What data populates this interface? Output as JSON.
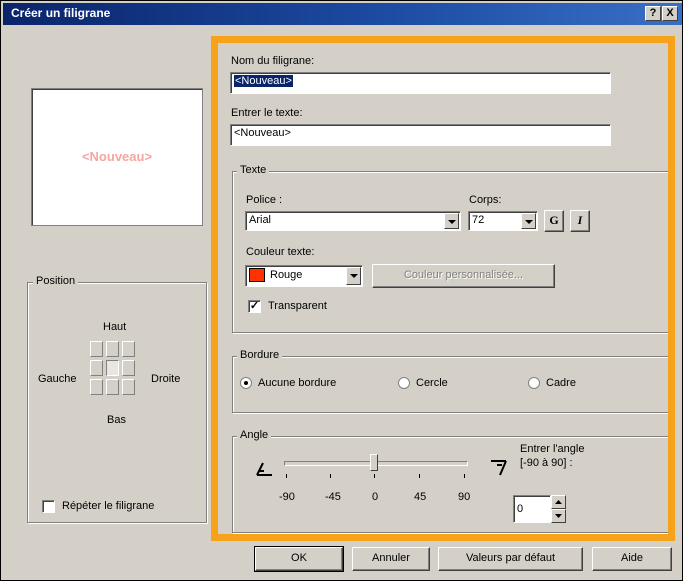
{
  "window": {
    "title": "Créer un filigrane",
    "help_button": "?",
    "close_button": "X"
  },
  "preview": {
    "text": "<Nouveau>"
  },
  "position_group": {
    "legend": "Position",
    "top": "Haut",
    "left": "Gauche",
    "right": "Droite",
    "bottom": "Bas",
    "selected": "center"
  },
  "repeat": {
    "label": "Répéter le filigrane",
    "checked": false
  },
  "name_field": {
    "label": "Nom du filigrane:",
    "value": "<Nouveau>"
  },
  "text_field": {
    "label": "Entrer le texte:",
    "value": "<Nouveau>"
  },
  "text_group": {
    "legend": "Texte",
    "font_label": "Police :",
    "font_value": "Arial",
    "size_label": "Corps:",
    "size_value": "72",
    "bold_label": "G",
    "italic_label": "I",
    "color_label": "Couleur texte:",
    "color_value": "Rouge",
    "color_swatch": "#ff3300",
    "custom_color_button": "Couleur personnalisée...",
    "transparent_label": "Transparent",
    "transparent_checked": true
  },
  "border_group": {
    "legend": "Bordure",
    "options": [
      "Aucune bordure",
      "Cercle",
      "Cadre"
    ],
    "selected": "Aucune bordure"
  },
  "angle_group": {
    "legend": "Angle",
    "ticks": [
      "-90",
      "-45",
      "0",
      "45",
      "90"
    ],
    "slider_value": 0,
    "entry_label_line1": "Entrer l'angle",
    "entry_label_line2": "[-90 à 90] :",
    "entry_value": "0"
  },
  "buttons": {
    "ok": "OK",
    "cancel": "Annuler",
    "defaults": "Valeurs par défaut",
    "help": "Aide"
  },
  "colors": {
    "highlight": "#f7a21b",
    "title_bar": "#0a246a"
  }
}
